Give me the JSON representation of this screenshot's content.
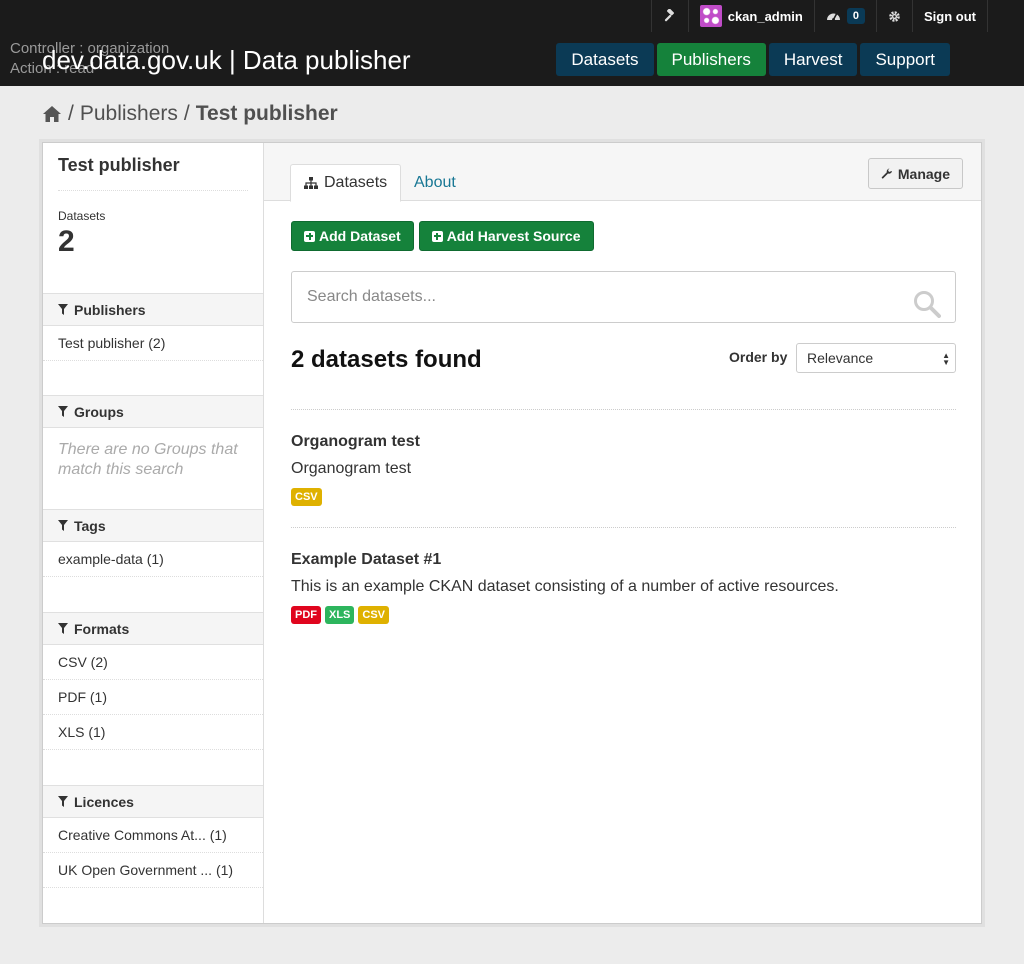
{
  "header": {
    "debug_controller": "Controller : organization",
    "debug_action": "Action : read",
    "site_title": "dev.data.gov.uk | Data publisher",
    "account": {
      "username": "ckan_admin",
      "activity_count": "0",
      "sign_out": "Sign out"
    },
    "nav": [
      {
        "label": "Datasets",
        "active": false
      },
      {
        "label": "Publishers",
        "active": true
      },
      {
        "label": "Harvest",
        "active": false
      },
      {
        "label": "Support",
        "active": false
      }
    ]
  },
  "breadcrumb": {
    "sep1": "/",
    "publishers": "Publishers",
    "sep2": "/",
    "current": "Test publisher"
  },
  "sidebar": {
    "org_title": "Test publisher",
    "stat_label": "Datasets",
    "stat_value": "2",
    "facets": {
      "publishers": {
        "title": "Publishers",
        "items": [
          "Test publisher (2)"
        ]
      },
      "groups": {
        "title": "Groups",
        "empty": "There are no Groups that match this search"
      },
      "tags": {
        "title": "Tags",
        "items": [
          "example-data (1)"
        ]
      },
      "formats": {
        "title": "Formats",
        "items": [
          "CSV (2)",
          "PDF (1)",
          "XLS (1)"
        ]
      },
      "licences": {
        "title": "Licences",
        "items": [
          "Creative Commons At... (1)",
          "UK Open Government ... (1)"
        ]
      }
    }
  },
  "content": {
    "tabs": {
      "datasets": "Datasets",
      "about": "About"
    },
    "manage": "Manage",
    "add_dataset": "Add Dataset",
    "add_harvest": "Add Harvest Source",
    "search_placeholder": "Search datasets...",
    "results_count": "2 datasets found",
    "order_label": "Order by",
    "order_value": "Relevance",
    "datasets": [
      {
        "title": "Organogram test",
        "notes": "Organogram test",
        "formats": [
          "CSV"
        ]
      },
      {
        "title": "Example Dataset #1",
        "notes": "This is an example CKAN dataset consisting of a number of active resources.",
        "formats": [
          "PDF",
          "XLS",
          "CSV"
        ]
      }
    ]
  },
  "colors": {
    "header_bg": "#1b1b1b",
    "nav_btn": "#0b3a55",
    "nav_active": "#15823b",
    "link": "#187794",
    "badge_csv": "#dfb100",
    "badge_pdf": "#e0051e",
    "badge_xls": "#2db55d"
  }
}
